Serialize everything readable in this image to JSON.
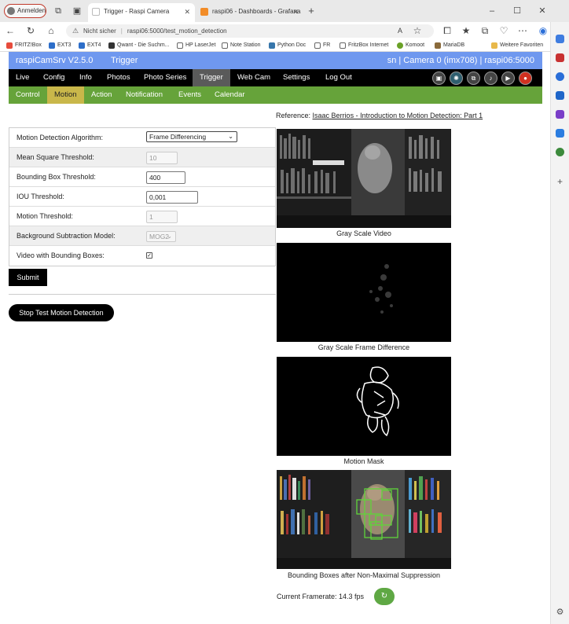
{
  "browser": {
    "profile_label": "Anmelden",
    "tabs": [
      {
        "title": "Trigger - Raspi Camera",
        "active": true
      },
      {
        "title": "raspi06 - Dashboards - Grafana",
        "active": false
      }
    ],
    "address": {
      "security": "Nicht sicher",
      "url": "raspi06:5000/test_motion_detection"
    },
    "bookmarks": [
      "FRITZ!Box",
      "EXT3",
      "EXT4",
      "Qwant - Die Suchm...",
      "HP LaserJet",
      "Note Station",
      "Python Doc",
      "FR",
      "FritzBox Internet",
      "Komoot",
      "MariaDB",
      "Weitere Favoriten"
    ]
  },
  "header": {
    "app_name": "raspiCamSrv V2.5.0",
    "page": "Trigger",
    "camera_info": "sn | Camera 0 (imx708) | raspi06:5000"
  },
  "main_nav": [
    "Live",
    "Config",
    "Info",
    "Photos",
    "Photo Series",
    "Trigger",
    "Web Cam",
    "Settings",
    "Log Out"
  ],
  "main_nav_active": "Trigger",
  "sub_nav": [
    "Control",
    "Motion",
    "Action",
    "Notification",
    "Events",
    "Calendar"
  ],
  "sub_nav_active": "Motion",
  "reference": {
    "prefix": "Reference:",
    "link": "Isaac Berrios - Introduction to Motion Detection: Part 1"
  },
  "form": {
    "algorithm": {
      "label": "Motion Detection Algorithm:",
      "value": "Frame Differencing"
    },
    "mse": {
      "label": "Mean Square Threshold:",
      "value": "10"
    },
    "bbox": {
      "label": "Bounding Box Threshold:",
      "value": "400"
    },
    "iou": {
      "label": "IOU Threshold:",
      "value": "0,001"
    },
    "motion": {
      "label": "Motion Threshold:",
      "value": "1"
    },
    "bg_model": {
      "label": "Background Subtraction Model:",
      "value": "MOG2"
    },
    "video_bbox": {
      "label": "Video with Bounding Boxes:",
      "checked": true,
      "glyph": "✓"
    }
  },
  "buttons": {
    "submit": "Submit",
    "stop": "Stop Test Motion Detection"
  },
  "images": {
    "gray": "Gray Scale Video",
    "diff": "Gray Scale Frame Difference",
    "mask": "Motion Mask",
    "bbox": "Bounding Boxes after Non-Maximal Suppression"
  },
  "framerate": "Current Framerate: 14.3 fps",
  "colors": {
    "header": "#6f98ef",
    "nav": "#000000",
    "subnav": "#66a33a",
    "subnav_active": "#c9b74a",
    "bbox": "#5fd43a"
  }
}
